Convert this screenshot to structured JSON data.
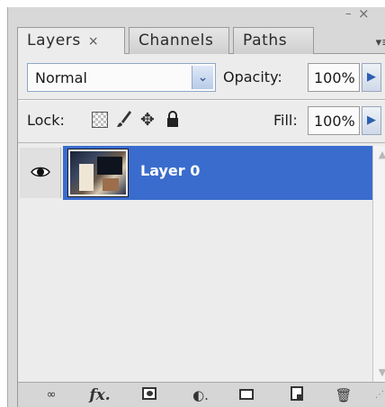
{
  "window": {
    "minimize_glyph": "–",
    "close_glyph": "×"
  },
  "tabs": [
    {
      "label": "Layers",
      "active": true,
      "close_glyph": "×"
    },
    {
      "label": "Channels",
      "active": false
    },
    {
      "label": "Paths",
      "active": false
    }
  ],
  "panel_menu_glyph": "▾≡",
  "blend_mode": {
    "value": "Normal",
    "arrow_glyph": "⌄"
  },
  "opacity": {
    "label": "Opacity:",
    "value": "100%",
    "arrow_glyph": "▶"
  },
  "lock": {
    "label": "Lock:",
    "icons": [
      "lock-transparent-icon",
      "lock-image-brush-icon",
      "lock-position-move-icon",
      "lock-all-padlock-icon"
    ]
  },
  "fill": {
    "label": "Fill:",
    "value": "100%",
    "arrow_glyph": "▶"
  },
  "layers": [
    {
      "name": "Layer 0",
      "visible": true,
      "selected": true
    }
  ],
  "colors": {
    "selection": "#3a6ccd",
    "panel_bg": "#ececec",
    "arrow_accent": "#2a5fb0"
  },
  "bottom_bar": {
    "link_glyph": "∞",
    "fx_label": "fx.",
    "adjust_glyph": "◐.",
    "trash_glyph": "🗑",
    "grip_glyph": "⋰"
  }
}
